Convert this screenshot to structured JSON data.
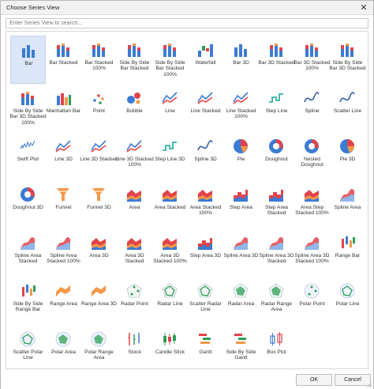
{
  "window": {
    "title": "Choose Series View",
    "close_glyph": "✕"
  },
  "search": {
    "placeholder": "Enter Series View to search..."
  },
  "footer": {
    "ok_label": "OK",
    "cancel_label": "Cancel"
  },
  "selected": "Bar",
  "series_views": [
    {
      "label": "Bar",
      "icon": "bar-chart-icon"
    },
    {
      "label": "Bar Stacked",
      "icon": "bar-stacked-icon"
    },
    {
      "label": "Bar Stacked 100%",
      "icon": "bar-stacked-100-icon"
    },
    {
      "label": "Side By Side Bar Stacked",
      "icon": "side-by-side-bar-stacked-icon"
    },
    {
      "label": "Side By Side Bar Stacked 100%",
      "icon": "side-by-side-bar-stacked-100-icon"
    },
    {
      "label": "Waterfall",
      "icon": "waterfall-icon"
    },
    {
      "label": "Bar 3D",
      "icon": "bar-3d-icon"
    },
    {
      "label": "Bar 3D Stacked",
      "icon": "bar-3d-stacked-icon"
    },
    {
      "label": "Bar 3D Stacked 100%",
      "icon": "bar-3d-stacked-100-icon"
    },
    {
      "label": "Side By Side Bar 3D Stacked",
      "icon": "side-by-side-bar-3d-stacked-icon"
    },
    {
      "label": "Side By Side Bar 3D Stacked 100%",
      "icon": "side-by-side-bar-3d-stacked-100-icon"
    },
    {
      "label": "Manhattan Bar",
      "icon": "manhattan-bar-icon"
    },
    {
      "label": "Point",
      "icon": "point-icon"
    },
    {
      "label": "Bubble",
      "icon": "bubble-icon"
    },
    {
      "label": "Line",
      "icon": "line-icon"
    },
    {
      "label": "Line Stacked",
      "icon": "line-stacked-icon"
    },
    {
      "label": "Line Stacked 100%",
      "icon": "line-stacked-100-icon"
    },
    {
      "label": "Step Line",
      "icon": "step-line-icon"
    },
    {
      "label": "Spline",
      "icon": "spline-icon"
    },
    {
      "label": "Scatter Line",
      "icon": "scatter-line-icon"
    },
    {
      "label": "Swift Plot",
      "icon": "swift-plot-icon"
    },
    {
      "label": "Line 3D",
      "icon": "line-3d-icon"
    },
    {
      "label": "Line 3D Stacked",
      "icon": "line-3d-stacked-icon"
    },
    {
      "label": "Line 3D Stacked 100%",
      "icon": "line-3d-stacked-100-icon"
    },
    {
      "label": "Step Line 3D",
      "icon": "step-line-3d-icon"
    },
    {
      "label": "Spline 3D",
      "icon": "spline-3d-icon"
    },
    {
      "label": "Pie",
      "icon": "pie-icon"
    },
    {
      "label": "Doughnut",
      "icon": "doughnut-icon"
    },
    {
      "label": "Nested Doughnut",
      "icon": "nested-doughnut-icon"
    },
    {
      "label": "Pie 3D",
      "icon": "pie-3d-icon"
    },
    {
      "label": "Doughnut 3D",
      "icon": "doughnut-3d-icon"
    },
    {
      "label": "Funnel",
      "icon": "funnel-icon"
    },
    {
      "label": "Funnel 3D",
      "icon": "funnel-3d-icon"
    },
    {
      "label": "Area",
      "icon": "area-icon"
    },
    {
      "label": "Area Stacked",
      "icon": "area-stacked-icon"
    },
    {
      "label": "Area Stacked 100%",
      "icon": "area-stacked-100-icon"
    },
    {
      "label": "Step Area",
      "icon": "step-area-icon"
    },
    {
      "label": "Step Area Stacked",
      "icon": "step-area-stacked-icon"
    },
    {
      "label": "Area Step Stacked 100%",
      "icon": "area-step-stacked-100-icon"
    },
    {
      "label": "Spline Area",
      "icon": "spline-area-icon"
    },
    {
      "label": "Spline Area Stacked",
      "icon": "spline-area-stacked-icon"
    },
    {
      "label": "Spline Area Stacked 100%",
      "icon": "spline-area-stacked-100-icon"
    },
    {
      "label": "Area 3D",
      "icon": "area-3d-icon"
    },
    {
      "label": "Area 3D Stacked",
      "icon": "area-3d-stacked-icon"
    },
    {
      "label": "Area 3D Stacked 100%",
      "icon": "area-3d-stacked-100-icon"
    },
    {
      "label": "Step Area 3D",
      "icon": "step-area-3d-icon"
    },
    {
      "label": "Spline Area 3D",
      "icon": "spline-area-3d-icon"
    },
    {
      "label": "Spline Area 3D Stacked",
      "icon": "spline-area-3d-stacked-icon"
    },
    {
      "label": "Spline Area 3D Stacked 100%",
      "icon": "spline-area-3d-stacked-100-icon"
    },
    {
      "label": "Range Bar",
      "icon": "range-bar-icon"
    },
    {
      "label": "Side By Side Range Bar",
      "icon": "side-by-side-range-bar-icon"
    },
    {
      "label": "Range Area",
      "icon": "range-area-icon"
    },
    {
      "label": "Range Area 3D",
      "icon": "range-area-3d-icon"
    },
    {
      "label": "Radar Point",
      "icon": "radar-point-icon"
    },
    {
      "label": "Radar Line",
      "icon": "radar-line-icon"
    },
    {
      "label": "Scatter Radar Line",
      "icon": "scatter-radar-line-icon"
    },
    {
      "label": "Radar Area",
      "icon": "radar-area-icon"
    },
    {
      "label": "Radar Range Area",
      "icon": "radar-range-area-icon"
    },
    {
      "label": "Polar Point",
      "icon": "polar-point-icon"
    },
    {
      "label": "Polar Line",
      "icon": "polar-line-icon"
    },
    {
      "label": "Scatter Polar Line",
      "icon": "scatter-polar-line-icon"
    },
    {
      "label": "Polar Area",
      "icon": "polar-area-icon"
    },
    {
      "label": "Polar Range Area",
      "icon": "polar-range-area-icon"
    },
    {
      "label": "Stock",
      "icon": "stock-icon"
    },
    {
      "label": "Candle Stick",
      "icon": "candle-stick-icon"
    },
    {
      "label": "Gantt",
      "icon": "gantt-icon"
    },
    {
      "label": "Side By Side Gantt",
      "icon": "side-by-side-gantt-icon"
    },
    {
      "label": "Box Plot",
      "icon": "box-plot-icon"
    }
  ],
  "colors": {
    "red": "#e2434b",
    "orange": "#f2994a",
    "blue": "#3b7bd4",
    "lightblue": "#8fb7e8",
    "green": "#2e9d57",
    "teal": "#37b3a5",
    "darkblue": "#2d5aa8",
    "selection": "#dbe6f6"
  }
}
